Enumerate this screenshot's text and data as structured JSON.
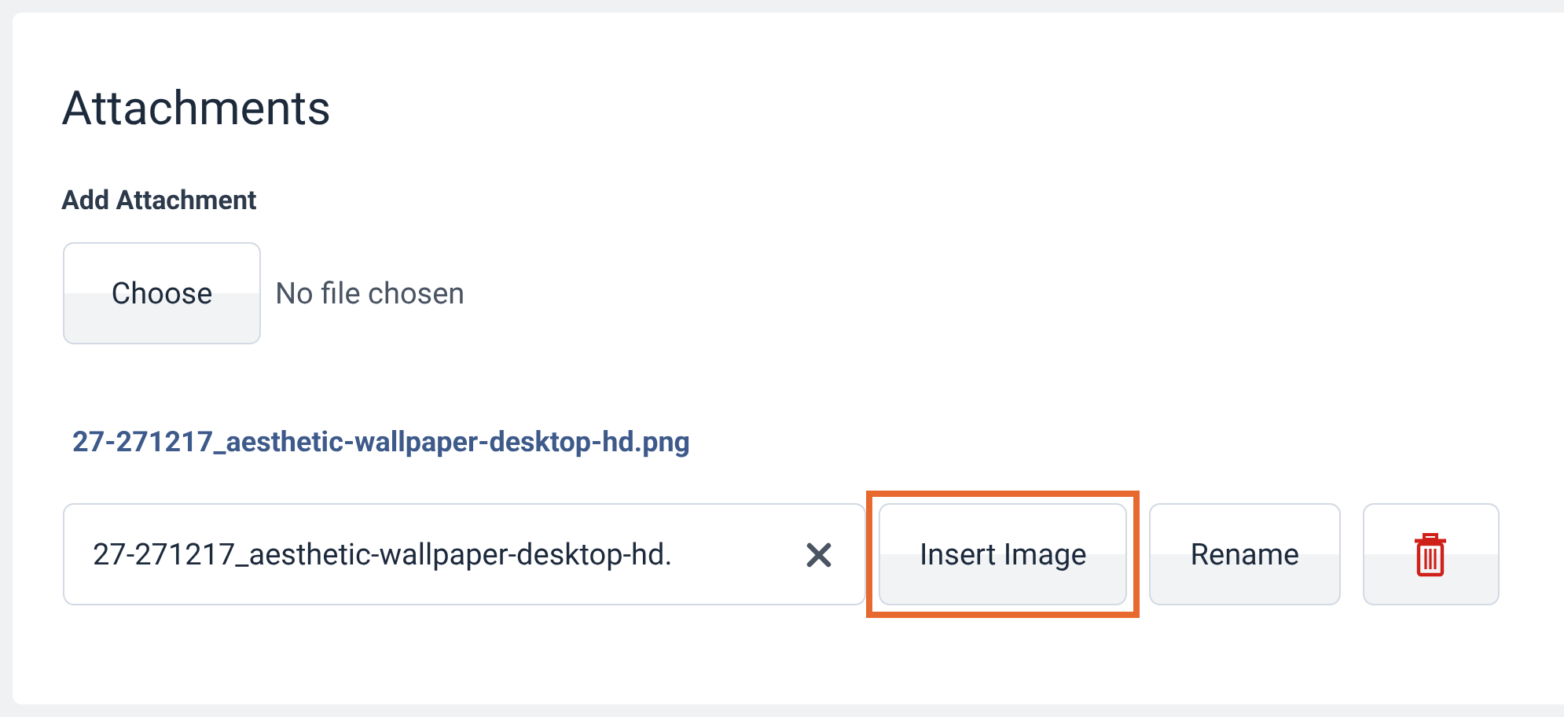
{
  "section": {
    "title": "Attachments"
  },
  "add_attachment": {
    "label": "Add Attachment",
    "button": "Choose",
    "status": "No file chosen"
  },
  "attachment": {
    "link": "27-271217_aesthetic-wallpaper-desktop-hd.png",
    "name_field": {
      "value": "27-271217_aesthetic-wallpaper-desktop-hd."
    },
    "actions": [
      {
        "kind": "text",
        "label": "Insert Image",
        "highlighted": true
      },
      {
        "kind": "text",
        "label": "Rename",
        "highlighted": false
      },
      {
        "kind": "delete",
        "highlighted": false
      }
    ]
  }
}
